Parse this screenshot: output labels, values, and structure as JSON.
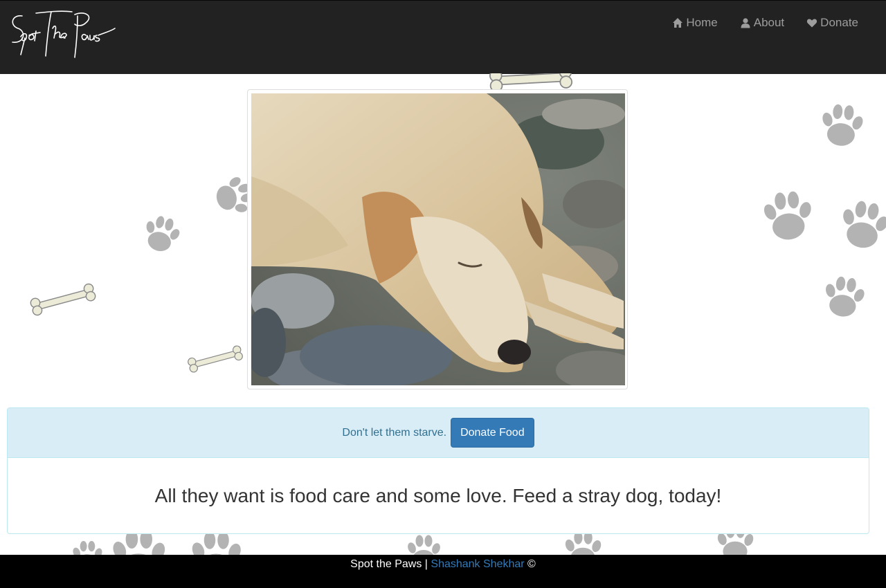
{
  "brand": {
    "logo_text": "Spot The Paws"
  },
  "nav": {
    "items": [
      {
        "label": "Home",
        "icon": "home-icon"
      },
      {
        "label": "About",
        "icon": "user-icon"
      },
      {
        "label": "Donate",
        "icon": "heart-icon"
      }
    ]
  },
  "hero": {
    "image": "sleeping-stray-dog-photo"
  },
  "panel": {
    "heading_text": "Don't let them starve.",
    "button_label": "Donate Food",
    "body_text": "All they want is food care and some love. Feed a stray dog, today!"
  },
  "footer": {
    "site": "Spot the Paws",
    "separator": "|",
    "author": "Shashank Shekhar",
    "copyright": "©"
  },
  "colors": {
    "navbar": "#222222",
    "panel_heading": "#d9edf7",
    "button": "#337ab7",
    "link": "#337ab7",
    "footer": "#000000",
    "paw": "#b3b3b3",
    "bone": "#ecebd8"
  }
}
